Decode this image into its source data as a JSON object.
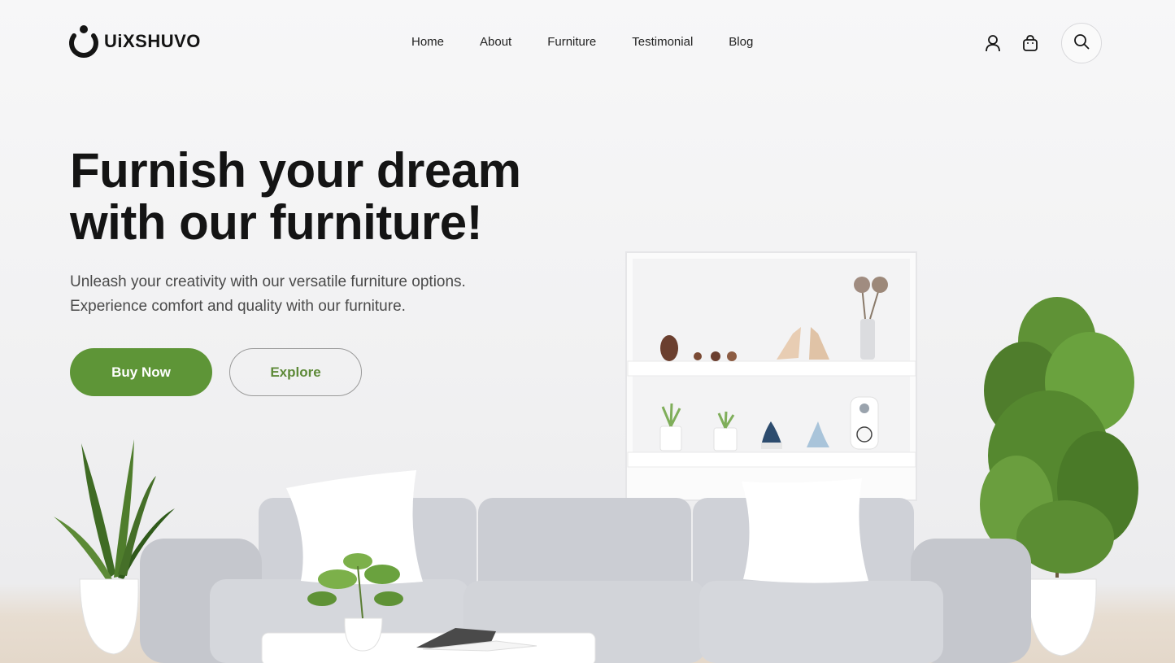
{
  "brand": {
    "name": "UiXSHUVO",
    "accent_color": "#5e9537",
    "logo_icon": "power-ring-logo-icon"
  },
  "nav": {
    "items": [
      {
        "label": "Home"
      },
      {
        "label": "About"
      },
      {
        "label": "Furniture"
      },
      {
        "label": "Testimonial"
      },
      {
        "label": "Blog"
      }
    ]
  },
  "header_icons": {
    "account": "user-icon",
    "cart": "shopping-bag-icon",
    "search": "search-icon"
  },
  "hero": {
    "title_line1": "Furnish your dream",
    "title_line2": "with our furniture!",
    "subtitle_line1": "Unleash your creativity with our versatile furniture options.",
    "subtitle_line2": "Experience comfort and quality with our furniture.",
    "primary_button": "Buy Now",
    "secondary_button": "Explore"
  },
  "scene": {
    "sofa_color": "#c9cbd1",
    "pillow_color": "#ffffff",
    "plant_color": "#4f7d2c",
    "floor_color": "#e4d8ca"
  }
}
